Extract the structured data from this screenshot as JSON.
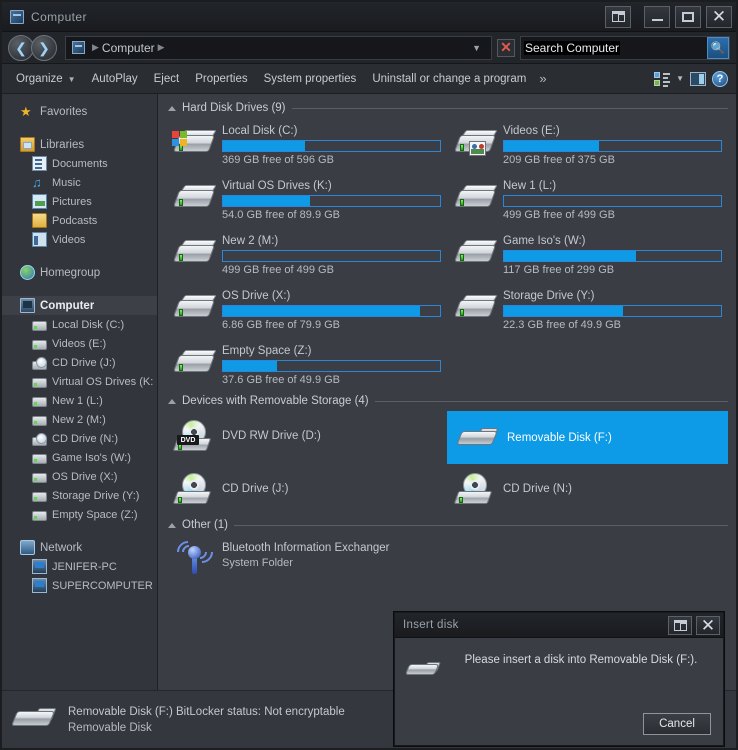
{
  "window": {
    "title": "Computer",
    "title_icon": "computer-icon",
    "buttons": {
      "restore_pane": "restore-layout-icon",
      "minimize": "minimize-icon",
      "maximize": "maximize-icon",
      "close": "close-icon"
    }
  },
  "address_bar": {
    "back": "back-arrow-icon",
    "forward": "forward-arrow-icon",
    "crumb": "Computer",
    "dropdown": "chevron-down-icon",
    "stop": "stop-icon",
    "search_value": "Search Computer",
    "search_placeholder": "Search Computer",
    "search_icon": "search-icon"
  },
  "toolbar": {
    "items": [
      {
        "label": "Organize",
        "caret": true
      },
      {
        "label": "AutoPlay",
        "caret": false
      },
      {
        "label": "Eject",
        "caret": false
      },
      {
        "label": "Properties",
        "caret": false
      },
      {
        "label": "System properties",
        "caret": false
      },
      {
        "label": "Uninstall or change a program",
        "caret": false
      }
    ],
    "overflow": "»",
    "views_icon": "views-icon",
    "views_caret": "chevron-down-icon",
    "preview_pane_icon": "preview-pane-icon",
    "help_icon": "help-icon",
    "help_glyph": "?"
  },
  "sidebar": {
    "groups": [
      {
        "header": {
          "label": "Favorites",
          "icon": "star-icon"
        },
        "items": []
      },
      {
        "header": {
          "label": "Libraries",
          "icon": "libraries-icon"
        },
        "items": [
          {
            "label": "Documents",
            "icon": "documents-icon"
          },
          {
            "label": "Music",
            "icon": "music-icon"
          },
          {
            "label": "Pictures",
            "icon": "pictures-icon"
          },
          {
            "label": "Podcasts",
            "icon": "folder-icon"
          },
          {
            "label": "Videos",
            "icon": "videos-icon"
          }
        ]
      },
      {
        "header": {
          "label": "Homegroup",
          "icon": "homegroup-icon"
        },
        "items": []
      },
      {
        "header": {
          "label": "Computer",
          "icon": "computer-icon",
          "selected": true
        },
        "items": [
          {
            "label": "Local Disk (C:)",
            "icon": "drive-icon"
          },
          {
            "label": "Videos (E:)",
            "icon": "drive-icon"
          },
          {
            "label": "CD Drive (J:)",
            "icon": "cd-drive-icon"
          },
          {
            "label": "Virtual OS Drives (K:",
            "icon": "drive-icon"
          },
          {
            "label": "New 1 (L:)",
            "icon": "drive-icon"
          },
          {
            "label": "New 2 (M:)",
            "icon": "drive-icon"
          },
          {
            "label": "CD Drive (N:)",
            "icon": "cd-drive-icon"
          },
          {
            "label": "Game Iso's (W:)",
            "icon": "drive-icon"
          },
          {
            "label": "OS Drive (X:)",
            "icon": "drive-icon"
          },
          {
            "label": "Storage Drive (Y:)",
            "icon": "drive-icon"
          },
          {
            "label": "Empty Space (Z:)",
            "icon": "drive-icon"
          }
        ]
      },
      {
        "header": {
          "label": "Network",
          "icon": "network-icon"
        },
        "items": [
          {
            "label": "JENIFER-PC",
            "icon": "network-computer-icon"
          },
          {
            "label": "SUPERCOMPUTER",
            "icon": "network-computer-icon"
          }
        ]
      }
    ]
  },
  "content": {
    "groups": [
      {
        "title": "Hard Disk Drives (9)",
        "collapse_icon": "triangle-up-icon"
      },
      {
        "title": "Devices with Removable Storage (4)",
        "collapse_icon": "triangle-up-icon"
      },
      {
        "title": "Other (1)",
        "collapse_icon": "triangle-up-icon"
      }
    ],
    "hard_drives": [
      {
        "name": "Local Disk (C:)",
        "free": "369 GB free of 596 GB",
        "fill_pct": 38,
        "icon": "windows-drive-icon"
      },
      {
        "name": "Videos (E:)",
        "free": "209 GB free of 375 GB",
        "fill_pct": 44,
        "icon": "shared-drive-icon"
      },
      {
        "name": "Virtual OS Drives (K:)",
        "free": "54.0 GB free of 89.9 GB",
        "fill_pct": 40,
        "icon": "drive-icon"
      },
      {
        "name": "New 1 (L:)",
        "free": "499 GB free of 499 GB",
        "fill_pct": 0,
        "icon": "drive-icon"
      },
      {
        "name": "New 2 (M:)",
        "free": "499 GB free of 499 GB",
        "fill_pct": 0,
        "icon": "drive-icon"
      },
      {
        "name": "Game Iso's (W:)",
        "free": "117 GB free of 299 GB",
        "fill_pct": 61,
        "icon": "drive-icon"
      },
      {
        "name": "OS Drive (X:)",
        "free": "6.86 GB free of 79.9 GB",
        "fill_pct": 91,
        "icon": "drive-icon"
      },
      {
        "name": "Storage Drive (Y:)",
        "free": "22.3 GB free of 49.9 GB",
        "fill_pct": 55,
        "icon": "drive-icon"
      },
      {
        "name": "Empty Space (Z:)",
        "free": "37.6 GB free of 49.9 GB",
        "fill_pct": 25,
        "icon": "drive-icon"
      }
    ],
    "removable": [
      {
        "name": "DVD RW Drive (D:)",
        "icon": "dvd-drive-icon",
        "label": "DVD",
        "selected": false
      },
      {
        "name": "Removable Disk (F:)",
        "icon": "usb-drive-icon",
        "selected": true
      },
      {
        "name": "CD Drive (J:)",
        "icon": "cd-drive-icon",
        "selected": false
      },
      {
        "name": "CD Drive (N:)",
        "icon": "cd-drive-icon",
        "selected": false
      }
    ],
    "other": [
      {
        "name": "Bluetooth Information Exchanger",
        "sub": "System Folder",
        "icon": "bluetooth-icon"
      }
    ]
  },
  "dialog": {
    "title": "Insert disk",
    "restore_icon": "restore-layout-icon",
    "close_icon": "close-icon",
    "icon": "usb-drive-icon",
    "message": "Please insert a disk into Removable Disk (F:).",
    "cancel_label": "Cancel"
  },
  "status": {
    "icon": "usb-drive-icon",
    "line1": "Removable Disk (F:)  BitLocker status:  Not encryptable",
    "line2": "Removable Disk"
  },
  "colors": {
    "accent_blue": "#0f9ae8",
    "selection_blue": "#0d9ae6",
    "window_bg": "#2f3238",
    "content_bg": "#3a3d43",
    "sidebar_bg": "#32353b",
    "text": "#c3c9d0"
  }
}
